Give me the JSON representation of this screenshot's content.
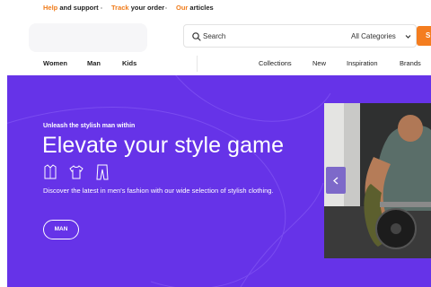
{
  "topbar": {
    "help": {
      "highlight": "Help",
      "rest": " and support"
    },
    "track": {
      "highlight": "Track",
      "rest": " your order"
    },
    "articles": {
      "highlight": "Our",
      "rest": " articles"
    }
  },
  "header": {
    "search_placeholder": "Search",
    "category": "All Categories",
    "search_button": "S"
  },
  "nav": {
    "left": [
      "Women",
      "Man",
      "Kids"
    ],
    "right": [
      "Collections",
      "New",
      "Inspiration",
      "Brands"
    ]
  },
  "hero": {
    "eyebrow": "Unleash the stylish man within",
    "title": "Elevate your style game",
    "description": "Discover the latest in men's fashion with our wide selection of stylish clothing.",
    "button": "MAN",
    "icons": [
      "shirt-icon",
      "tshirt-icon",
      "trousers-icon"
    ]
  },
  "colors": {
    "accent": "#f47d1f",
    "hero_bg": "#6633e8"
  }
}
